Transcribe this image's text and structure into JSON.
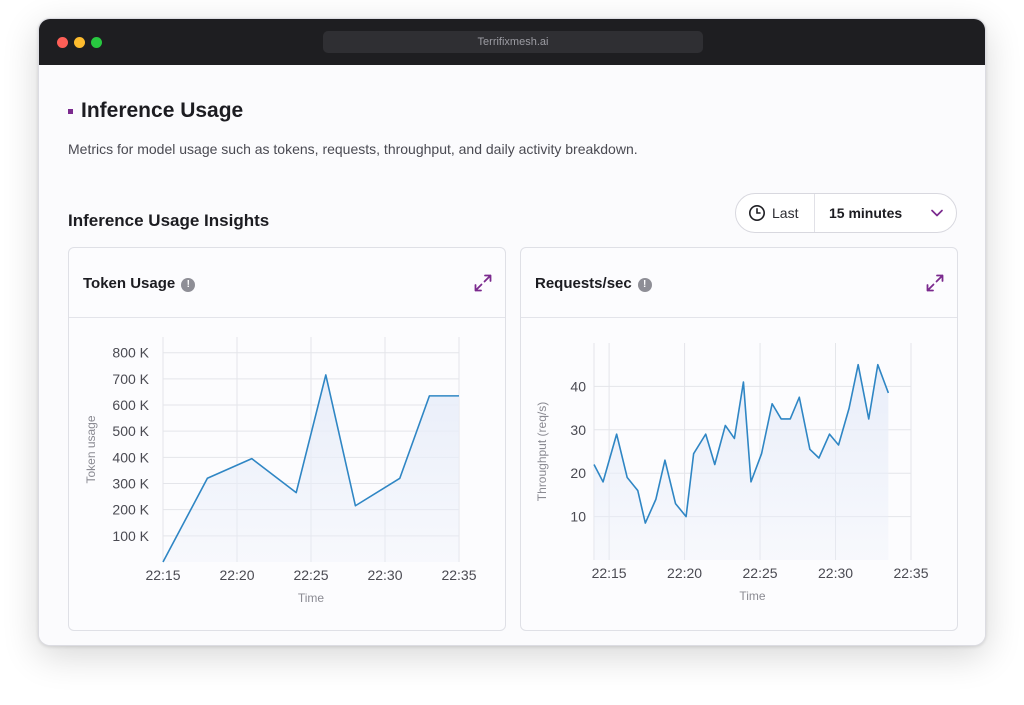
{
  "window": {
    "url": "Terrifixmesh.ai"
  },
  "page": {
    "title": "Inference Usage",
    "description": "Metrics for model usage such as tokens, requests, throughput, and daily activity breakdown.",
    "section_title": "Inference Usage Insights"
  },
  "time_range": {
    "prefix": "Last",
    "value": "15 minutes"
  },
  "icons": {
    "clock": "clock-icon",
    "chevron": "chevron-down-icon",
    "info": "info-icon",
    "expand": "expand-icon"
  },
  "colors": {
    "accent": "#7b2a8e",
    "line": "#2f86c4",
    "fill": "#e9eef9"
  },
  "cards": {
    "token": {
      "title": "Token Usage",
      "info": "!"
    },
    "requests": {
      "title": "Requests/sec",
      "info": "!"
    }
  },
  "chart_data": [
    {
      "type": "area",
      "xlabel": "Time",
      "ylabel": "Token usage",
      "x_ticks": [
        "22:15",
        "22:20",
        "22:25",
        "22:30",
        "22:35"
      ],
      "y_ticks": [
        "100 K",
        "200 K",
        "300 K",
        "400 K",
        "500 K",
        "600 K",
        "700 K",
        "800 K"
      ],
      "x_minutes": [
        15,
        18,
        21,
        24,
        26,
        28,
        31,
        33,
        35
      ],
      "values": [
        0,
        320000,
        395000,
        265000,
        715000,
        215000,
        320000,
        635000,
        635000
      ],
      "xlim": [
        15,
        35
      ],
      "ylim": [
        0,
        860000
      ],
      "grid": true
    },
    {
      "type": "area",
      "xlabel": "Time",
      "ylabel": "Throughput (req/s)",
      "x_ticks": [
        "22:15",
        "22:20",
        "22:25",
        "22:30",
        "22:35"
      ],
      "y_ticks": [
        "10",
        "20",
        "30",
        "40"
      ],
      "x_minutes": [
        14,
        14.6,
        15.5,
        16.2,
        16.9,
        17.4,
        18.1,
        18.7,
        19.4,
        20.1,
        20.6,
        21.4,
        22.0,
        22.7,
        23.3,
        23.9,
        24.4,
        25.1,
        25.8,
        26.4,
        27.0,
        27.6,
        28.3,
        28.9,
        29.6,
        30.2,
        30.9,
        31.5,
        32.2,
        32.8,
        33.5,
        34.1,
        34.8
      ],
      "values": [
        22,
        18,
        29,
        19,
        16,
        8.5,
        14,
        23,
        13,
        10,
        24.5,
        29,
        22,
        31,
        28,
        41,
        18,
        24.5,
        36,
        32.5,
        32.5,
        37.5,
        25.5,
        23.5,
        29,
        26.5,
        35,
        45,
        32.5,
        45,
        38.5
      ],
      "xlim": [
        14,
        35
      ],
      "ylim": [
        0,
        50
      ],
      "grid": true
    }
  ]
}
